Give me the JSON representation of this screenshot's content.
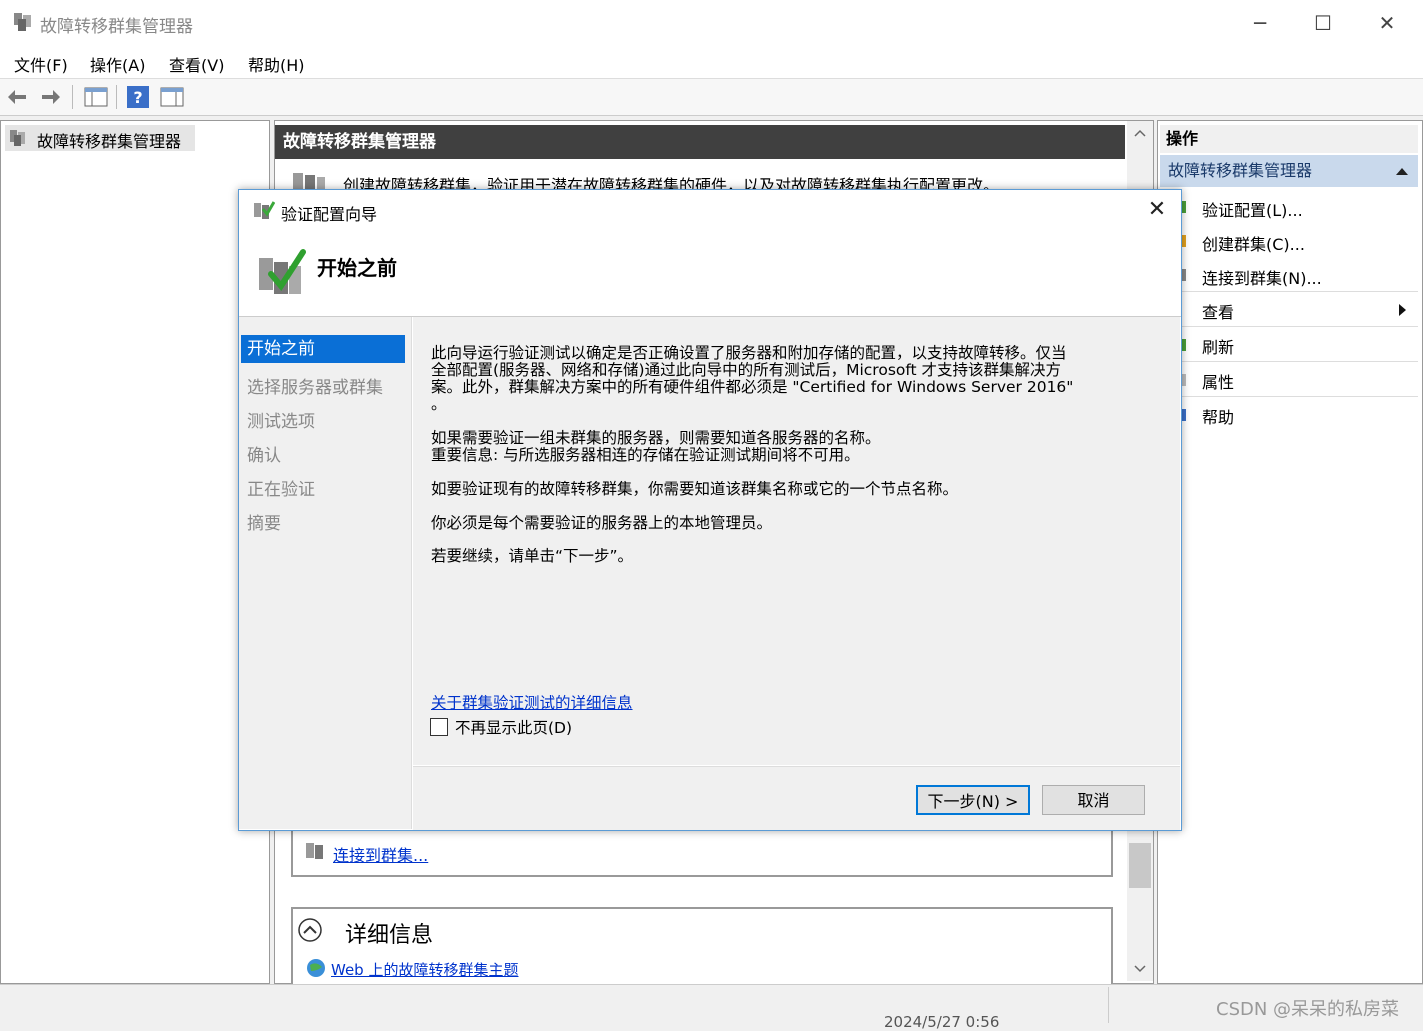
{
  "app": {
    "title": "故障转移群集管理器"
  },
  "menu": [
    "文件(F)",
    "操作(A)",
    "查看(V)",
    "帮助(H)"
  ],
  "tree": {
    "root_label": "故障转移群集管理器"
  },
  "center": {
    "header": "故障转移群集管理器",
    "intro_text": "创建故障转移群集，验证用于潜在故障转移群集的硬件，以及对故障转移群集执行配置更改。",
    "connect_link": "连接到群集...",
    "details_title": "详细信息",
    "web_link": "Web 上的故障转移群集主题"
  },
  "actions": {
    "header": "操作",
    "subheader": "故障转移群集管理器",
    "items": [
      "验证配置(L)...",
      "创建群集(C)...",
      "连接到群集(N)...",
      "查看",
      "刷新",
      "属性",
      "帮助"
    ]
  },
  "status": {
    "timestamp": "2024/5/27 0:56",
    "watermark": "CSDN @呆呆的私房菜"
  },
  "dialog": {
    "title": "验证配置向导",
    "heading": "开始之前",
    "nav": [
      "开始之前",
      "选择服务器或群集",
      "测试选项",
      "确认",
      "正在验证",
      "摘要"
    ],
    "paragraphs": {
      "p1_line1": "此向导运行验证测试以确定是否正确设置了服务器和附加存储的配置，以支持故障转移。仅当",
      "p1_line2": "全部配置(服务器、网络和存储)通过此向导中的所有测试后，Microsoft 才支持该群集解决方",
      "p1_line3": "案。此外，群集解决方案中的所有硬件组件都必须是 \"Certified for Windows Server 2016\"",
      "p1_line4": "。",
      "p2_line1": "如果需要验证一组未群集的服务器，则需要知道各服务器的名称。",
      "p2_line2": "重要信息: 与所选服务器相连的存储在验证测试期间将不可用。",
      "p3": "如要验证现有的故障转移群集，你需要知道该群集名称或它的一个节点名称。",
      "p4": "你必须是每个需要验证的服务器上的本地管理员。",
      "p5": "若要继续，请单击“下一步”。"
    },
    "more_info_link": "关于群集验证测试的详细信息",
    "dont_show_label": "不再显示此页(D)",
    "next_button": "下一步(N) >",
    "cancel_button": "取消"
  }
}
